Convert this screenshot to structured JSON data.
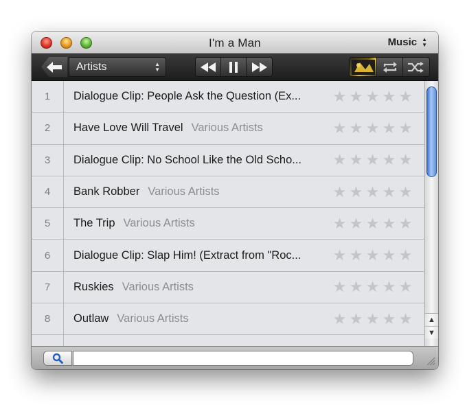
{
  "window": {
    "title": "I'm a Man",
    "source_select": "Music"
  },
  "toolbar": {
    "back_icon": "arrow-left-icon",
    "browse_select": "Artists",
    "transport": [
      "rewind-icon",
      "pause-icon",
      "fast-forward-icon"
    ],
    "right_buttons": [
      "album-art-icon",
      "repeat-icon",
      "shuffle-icon"
    ]
  },
  "tracks": [
    {
      "num": "1",
      "title": "Dialogue Clip: People Ask the Question (Ex...",
      "artist": "",
      "rating": 0
    },
    {
      "num": "2",
      "title": "Have Love Will Travel",
      "artist": "Various Artists",
      "rating": 0
    },
    {
      "num": "3",
      "title": "Dialogue Clip: No School Like the Old Scho...",
      "artist": "",
      "rating": 0
    },
    {
      "num": "4",
      "title": "Bank Robber",
      "artist": "Various Artists",
      "rating": 0
    },
    {
      "num": "5",
      "title": "The Trip",
      "artist": "Various Artists",
      "rating": 0
    },
    {
      "num": "6",
      "title": "Dialogue Clip: Slap Him! (Extract from \"Roc...",
      "artist": "",
      "rating": 0
    },
    {
      "num": "7",
      "title": "Ruskies",
      "artist": "Various Artists",
      "rating": 0
    },
    {
      "num": "8",
      "title": "Outlaw",
      "artist": "Various Artists",
      "rating": 0
    }
  ],
  "search": {
    "icon": "search-icon",
    "value": "",
    "placeholder": ""
  },
  "colors": {
    "close": "#e0352a",
    "minimize": "#e99a1f",
    "zoom": "#5fb73a",
    "scroll_thumb": "#5f91df",
    "search_icon": "#1e5fc4"
  }
}
